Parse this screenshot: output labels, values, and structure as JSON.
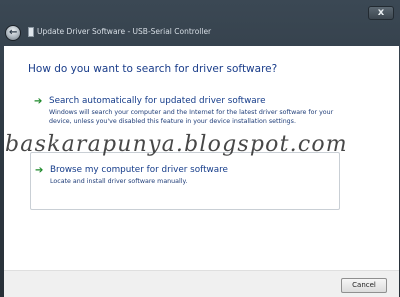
{
  "window": {
    "title": "Update Driver Software - USB-Serial Controller",
    "close_label": "x",
    "back_glyph": "←"
  },
  "heading": "How do you want to search for driver software?",
  "options": [
    {
      "arrow": "➔",
      "title": "Search automatically for updated driver software",
      "description": "Windows will search your computer and the Internet for the latest driver software for your device, unless you've disabled this feature in your device installation settings."
    },
    {
      "arrow": "➔",
      "title": "Browse my computer for driver software",
      "description": "Locate and install driver software manually."
    }
  ],
  "footer": {
    "cancel_label": "Cancel"
  },
  "watermark": "baskarapunya.blogspot.com",
  "colors": {
    "link_blue": "#153c8a",
    "arrow_green": "#1f8a2c",
    "heading_blue": "#1a3d8a"
  },
  "icons": {
    "back": "back-arrow-icon",
    "close": "close-icon",
    "document": "document-icon",
    "option_arrow": "green-arrow-icon"
  }
}
